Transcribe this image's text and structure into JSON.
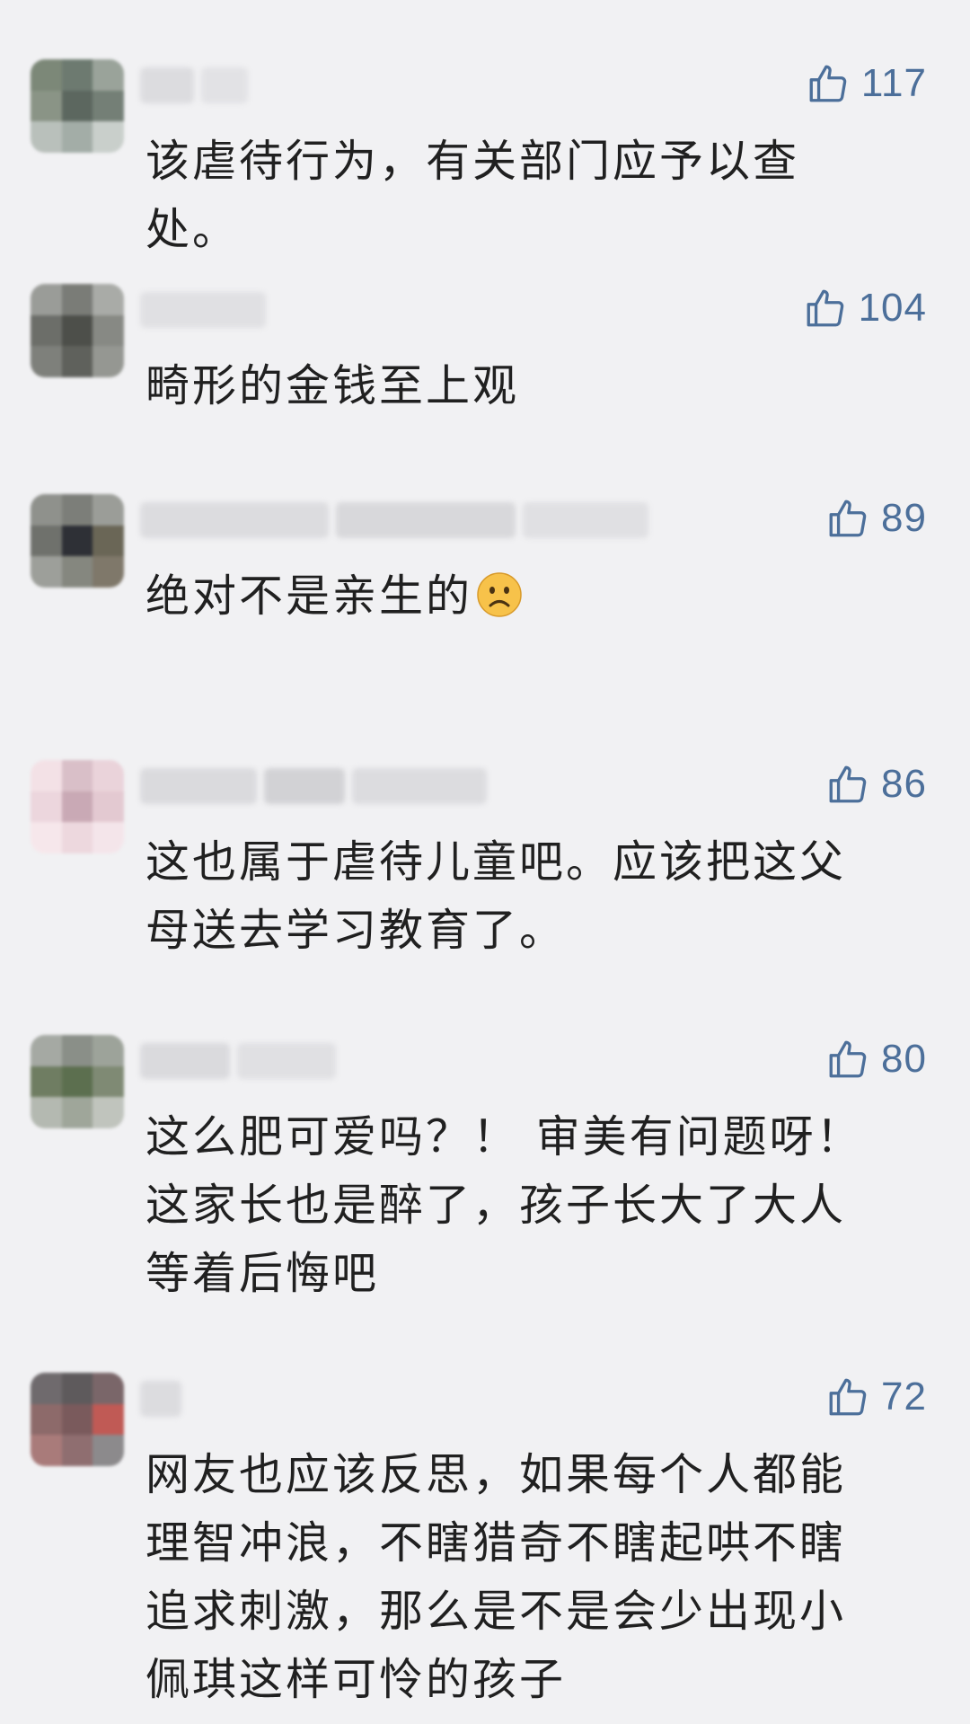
{
  "comments": [
    {
      "likes": "117",
      "text": "该虐待行为，有关部门应予以查\n处。"
    },
    {
      "likes": "104",
      "text": "畸形的金钱至上观"
    },
    {
      "likes": "89",
      "text": "绝对不是亲生的",
      "emoji": "sad-face-emoji"
    },
    {
      "likes": "86",
      "text": "这也属于虐待儿童吧。应该把这父\n母送去学习教育了。"
    },
    {
      "likes": "80",
      "text": "这么肥可爱吗？！ 审美有问题呀！\n这家长也是醉了，孩子长大了大人\n等着后悔吧"
    },
    {
      "likes": "72",
      "text": "网友也应该反思，如果每个人都能\n理智冲浪，不瞎猎奇不瞎起哄不瞎\n追求刺激，那么是不是会少出现小\n佩琪这样可怜的孩子"
    }
  ],
  "icons": {
    "like": "thumbs-up-icon"
  },
  "colors": {
    "background": "#f1f1f3",
    "like_count": "#4c6f9a",
    "text": "#202020"
  }
}
